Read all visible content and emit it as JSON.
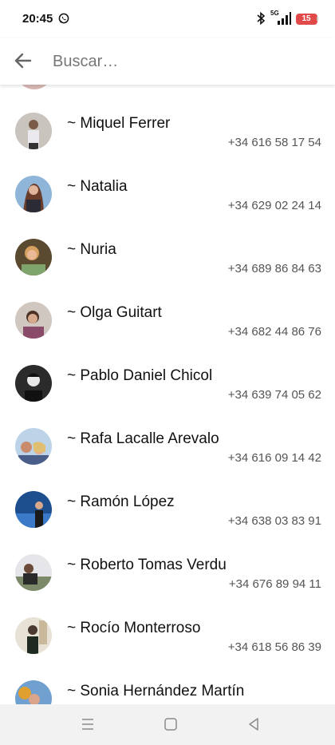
{
  "status_bar": {
    "time": "20:45",
    "network": "5G",
    "battery": "15",
    "battery_color": "#e24a4a"
  },
  "search": {
    "placeholder": "Buscar…",
    "value": ""
  },
  "contacts": [
    {
      "name": "~ Miquel Ferrer",
      "phone": "+34 616 58 17 54"
    },
    {
      "name": "~ Natalia",
      "phone": "+34 629 02 24 14"
    },
    {
      "name": "~ Nuria",
      "phone": "+34 689 86 84 63"
    },
    {
      "name": "~ Olga Guitart",
      "phone": "+34 682 44 86 76"
    },
    {
      "name": "~ Pablo Daniel Chicol",
      "phone": "+34 639 74 05 62"
    },
    {
      "name": "~ Rafa Lacalle Arevalo",
      "phone": "+34 616 09 14 42"
    },
    {
      "name": "~ Ramón López",
      "phone": "+34 638 03 83 91"
    },
    {
      "name": "~ Roberto Tomas Verdu",
      "phone": "+34 676 89 94 11"
    },
    {
      "name": "~ Rocío Monterroso",
      "phone": "+34 618 56 86 39"
    },
    {
      "name": "~ Sonia Hernández Martín",
      "phone": ""
    }
  ],
  "icons": {
    "back": "arrow-left-icon",
    "nav_menu": "menu-icon",
    "nav_home": "home-square-icon",
    "nav_back": "triangle-back-icon"
  }
}
